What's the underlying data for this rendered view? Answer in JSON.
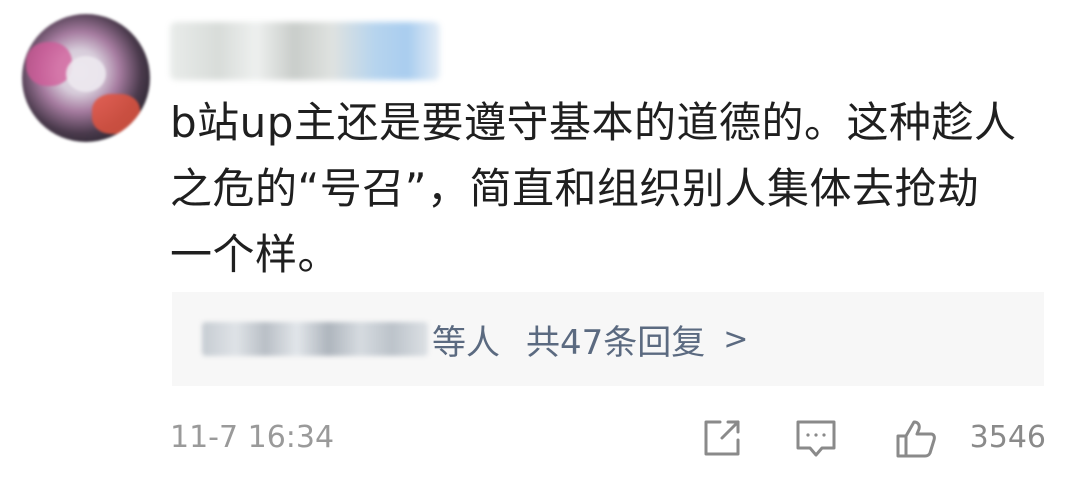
{
  "comment": {
    "text_lines": [
      "b站up主还是要遵守基本的道德的。这种趁人",
      "之危的“号召”，简直和组织别人集体去抢劫",
      "一个样。"
    ]
  },
  "replies": {
    "suffix": "等人",
    "count_label": "共47条回复",
    "chevron": ">"
  },
  "footer": {
    "timestamp": "11-7 16:34",
    "like_count": "3546"
  },
  "icons": {
    "share": "share-icon",
    "reply": "comment-icon",
    "like": "thumbs-up-icon"
  },
  "colors": {
    "link": "#5b6a80",
    "meta": "#9a9a9a",
    "reply_bg": "#f7f7f7"
  }
}
